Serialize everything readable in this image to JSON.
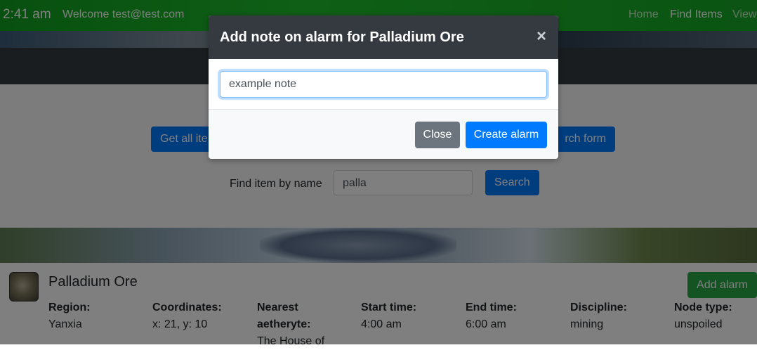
{
  "navbar": {
    "clock": "2:41 am",
    "welcome": "Welcome test@test.com",
    "links": [
      "Home",
      "Find Items",
      "View"
    ]
  },
  "search": {
    "get_all_label": "Get all ite",
    "search_form_label": "rch form",
    "find_label": "Find item by name",
    "find_value": "palla",
    "search_button": "Search"
  },
  "item": {
    "name": "Palladium Ore",
    "add_alarm": "Add alarm",
    "fields": [
      {
        "label": "Region:",
        "value": "Yanxia"
      },
      {
        "label": "Coordinates:",
        "value": "x: 21, y: 10"
      },
      {
        "label": "Nearest aetheryte:",
        "value": "The House of"
      },
      {
        "label": "Start time:",
        "value": "4:00 am"
      },
      {
        "label": "End time:",
        "value": "6:00 am"
      },
      {
        "label": "Discipline:",
        "value": "mining"
      },
      {
        "label": "Node type:",
        "value": "unspoiled"
      }
    ]
  },
  "modal": {
    "title": "Add note on alarm for Palladium Ore",
    "close_symbol": "×",
    "note_value": "example note",
    "close_button": "Close",
    "create_button": "Create alarm"
  },
  "colors": {
    "primary": "#007bff",
    "success": "#28a745",
    "secondary": "#6c757d",
    "dark": "#343a40",
    "navbar_green": "#1fbf2c"
  }
}
